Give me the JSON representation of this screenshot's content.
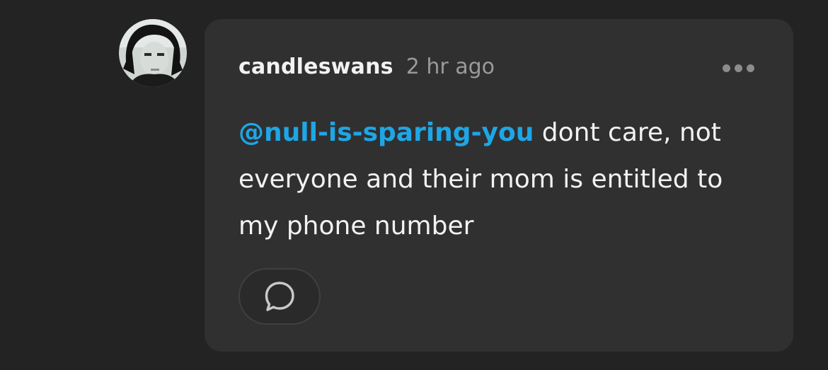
{
  "comment": {
    "author": "candleswans",
    "timestamp": "2 hr ago",
    "mention": "@null-is-sparing-you",
    "text_after_mention": " dont care, not everyone and their mom is entitled to my phone number",
    "more_icon": "ellipsis-icon",
    "reply_icon": "speech-bubble-icon"
  },
  "colors": {
    "background": "#232323",
    "card": "#303030",
    "mention": "#1ea6e6",
    "timestamp": "#9a9a9a",
    "text": "#f2f2f2"
  }
}
